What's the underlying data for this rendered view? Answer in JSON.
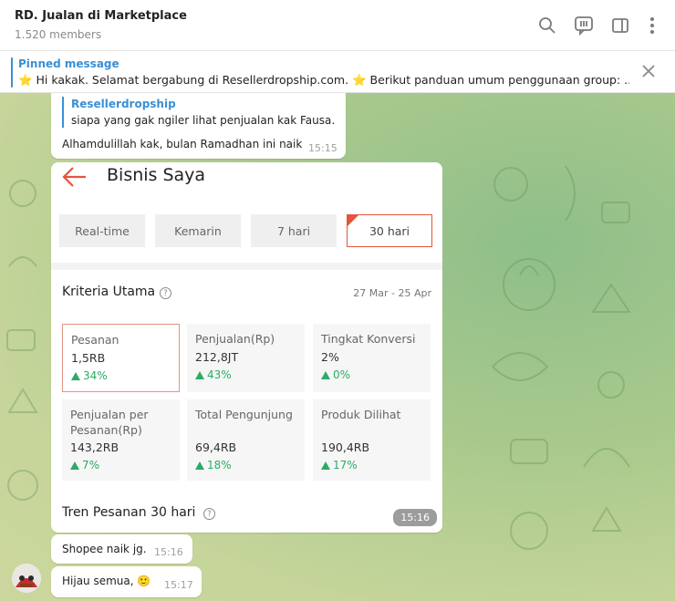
{
  "header": {
    "title": "RD. Jualan di Marketplace",
    "subtitle": "1.520 members",
    "icons": [
      "search-icon",
      "video-chat-icon",
      "sidebar-toggle-icon",
      "more-vert-icon"
    ]
  },
  "pinned": {
    "title": "Pinned message",
    "text": "⭐ Hi kakak. Selamat bergabung di Resellerdropship.com. ⭐  Berikut panduan umum penggunaan group:  ..."
  },
  "messages": {
    "m1": {
      "reply_name": "Resellerdropship",
      "reply_text": "siapa yang gak ngiler lihat penjualan kak Fausa…",
      "text": "Alhamdulillah kak, bulan Ramadhan ini naik",
      "time": "15:15"
    },
    "m2": {
      "time": "15:16",
      "app": {
        "title": "Bisnis Saya",
        "tabs": [
          {
            "label": "Real-time"
          },
          {
            "label": "Kemarin"
          },
          {
            "label": "7 hari"
          },
          {
            "label": "30 hari"
          }
        ],
        "active_tab": "30 hari",
        "section_title": "Kriteria Utama",
        "help_glyph": "?",
        "date_range": "27 Mar - 25 Apr",
        "metrics": [
          {
            "label": "Pesanan",
            "value": "1,5RB",
            "change": "34%"
          },
          {
            "label": "Penjualan(Rp)",
            "value": "212,8JT",
            "change": "43%"
          },
          {
            "label": "Tingkat Konversi",
            "value": "2%",
            "change": "0%"
          },
          {
            "label": "Penjualan per Pesanan(Rp)",
            "value": "143,2RB",
            "change": "7%"
          },
          {
            "label": "Total Pengunjung",
            "value": "69,4RB",
            "change": "18%"
          },
          {
            "label": "Produk Dilihat",
            "value": "190,4RB",
            "change": "17%"
          }
        ],
        "trend_title": "Tren Pesanan 30 hari"
      }
    },
    "m3": {
      "text": "Shopee naik jg.",
      "time": "15:16"
    },
    "m4": {
      "text": "Hijau semua, 🙂",
      "time": "15:17"
    }
  },
  "colors": {
    "accent": "#3a8fd6",
    "shopee_orange": "#e5553d",
    "positive": "#2bab66",
    "chat_bg": "#a9c98c"
  }
}
